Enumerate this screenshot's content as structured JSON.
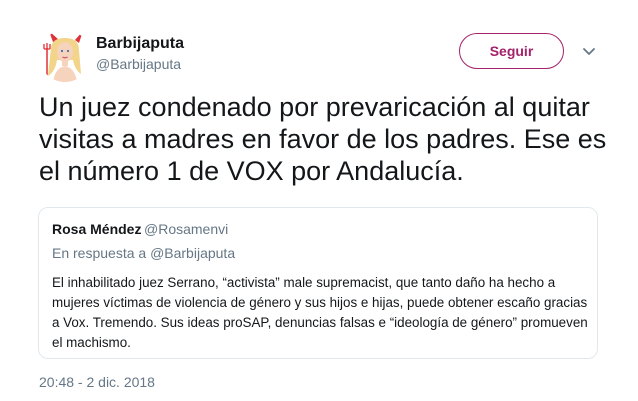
{
  "author": {
    "display_name": "Barbijaputa",
    "handle": "@Barbijaputa"
  },
  "follow_button": {
    "label": "Seguir",
    "color": "#a3226a"
  },
  "tweet": {
    "text": "Un juez condenado por prevaricación al quitar visitas a madres en favor de los padres. Ese es el número 1 de VOX por Andalucía.",
    "timestamp": "20:48 - 2 dic. 2018"
  },
  "quoted_tweet": {
    "display_name": "Rosa Méndez",
    "handle": "@Rosamenvi",
    "reply_prefix": "En respuesta a",
    "reply_to": "@Barbijaputa",
    "text": "El inhabilitado juez Serrano, “activista” male supremacist, que tanto daño ha hecho a mujeres víctimas de violencia de género y sus hijos e hijas, puede obtener escaño gracias a Vox. Tremendo. Sus ideas proSAP, denuncias falsas e “ideología de género” promueven el machismo."
  },
  "icons": {
    "menu": "chevron-down-icon",
    "avatar": "avatar"
  },
  "colors": {
    "text_primary": "#14171a",
    "text_secondary": "#657786",
    "border": "#e1e8ed"
  }
}
